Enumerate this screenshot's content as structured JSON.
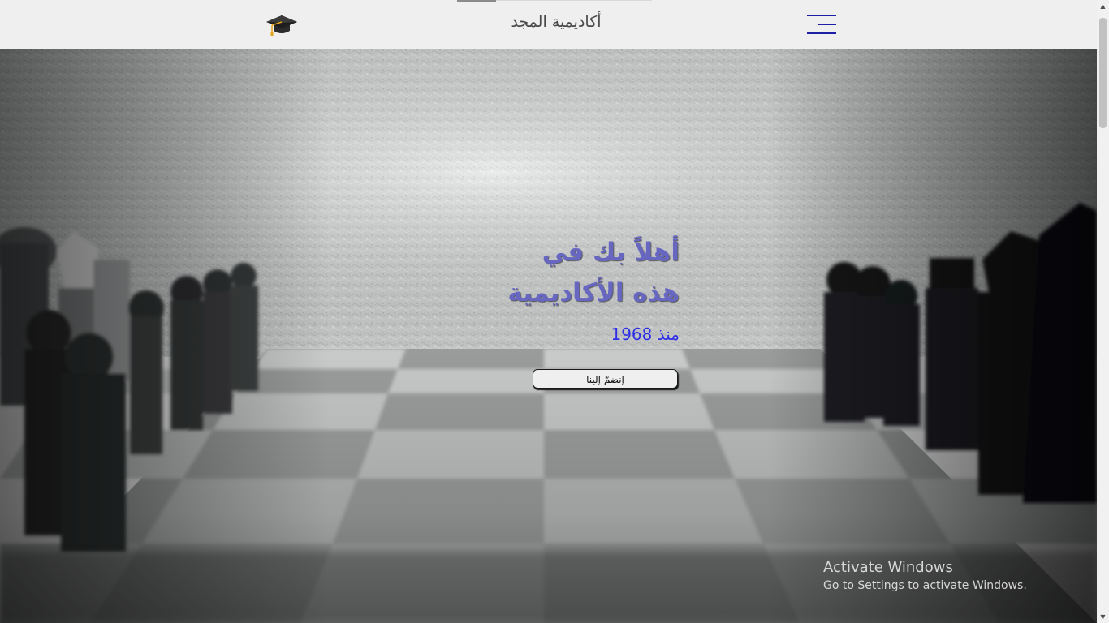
{
  "header": {
    "site_title": "أكاديمية المجد",
    "menu_icon": "hamburger-menu-icon",
    "logo_icon": "graduation-cap-icon",
    "progress": 0.2
  },
  "hero": {
    "title": "أهلاً بك في هذه الأكاديمية",
    "subtitle": "منذ 1968",
    "join_button": "إنضمّ إلينا",
    "background": "chess-board-photo"
  },
  "watermark": {
    "title": "Activate Windows",
    "subtitle": "Go to Settings to activate Windows."
  },
  "scrollbar": {
    "up_icon": "▲",
    "down_icon": "▼"
  },
  "colors": {
    "title": "#6767c2",
    "subtitle": "#2e2ee6",
    "menu": "#1f1fa6",
    "header_bg": "#efefef"
  }
}
